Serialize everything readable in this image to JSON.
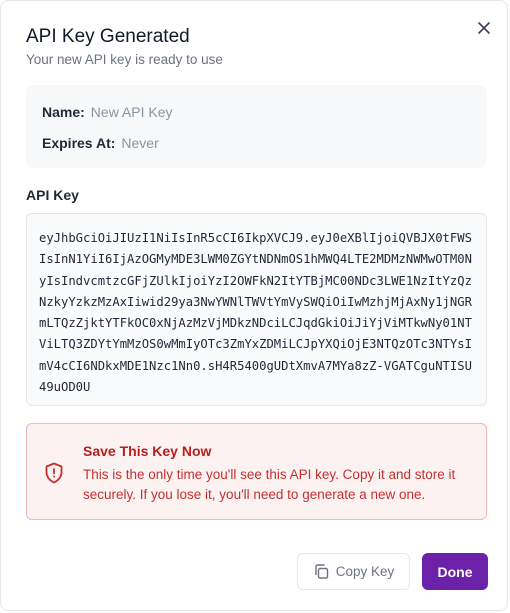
{
  "dialog": {
    "title": "API Key Generated",
    "subtitle": "Your new API key is ready to use",
    "close_icon": "close-icon"
  },
  "info": {
    "name_label": "Name:",
    "name_value": "New API Key",
    "expires_label": "Expires At:",
    "expires_value": "Never"
  },
  "api_key": {
    "label": "API Key",
    "value": "eyJhbGciOiJIUzI1NiIsInR5cCI6IkpXVCJ9.eyJ0eXBlIjoiQVBJX0tFWSIsInN1YiI6IjAzOGMyMDE3LWM0ZGYtNDNmOS1hMWQ4LTE2MDMzNWMwOTM0NyIsIndvcmtzcGFjZUlkIjoiYzI2OWFkN2ItYTBjMC00NDc3LWE1NzItYzQzNzkyYzkzMzAxIiwid29ya3NwYWNlTWVtYmVySWQiOiIwMzhjMjAxNy1jNGRmLTQzZjktYTFkOC0xNjAzMzVjMDkzNDciLCJqdGkiOiJiYjViMTkwNy01NTViLTQ3ZDYtYmMzOS0wMmIyOTc3ZmYxZDMiLCJpYXQiOjE3NTQzOTc3NTYsImV4cCI6NDkxMDE1Nzc1Nn0.sH4R5400gUDtXmvA7MYa8zZ-VGATCguNTISU49uOD0U"
  },
  "warning": {
    "title": "Save This Key Now",
    "body": "This is the only time you'll see this API key. Copy it and store it securely. If you lose it, you'll need to generate a new one.",
    "icon": "shield-alert-icon",
    "color": "#b91c1c"
  },
  "actions": {
    "copy_label": "Copy Key",
    "done_label": "Done",
    "accent": "#6b21a8"
  }
}
